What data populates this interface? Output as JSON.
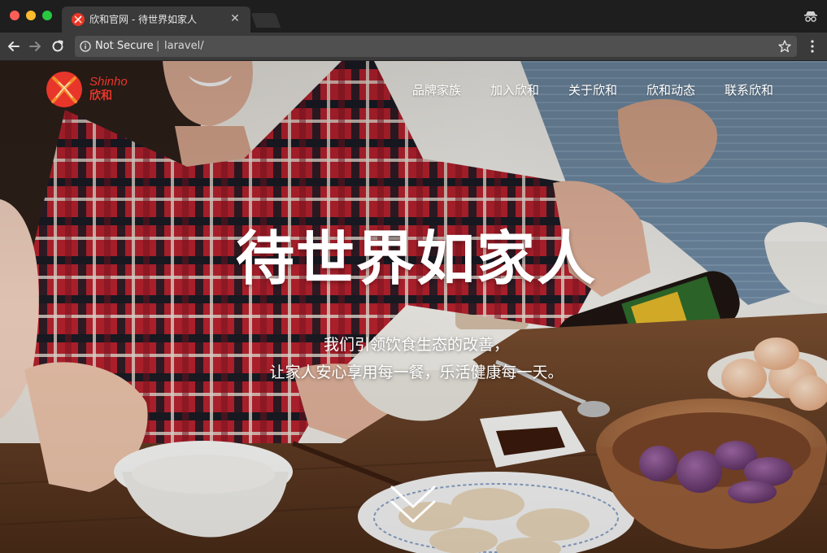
{
  "browser": {
    "tab": {
      "title": "欣和官网 - 待世界如家人"
    },
    "toolbar": {
      "security_label": "Not Secure",
      "separator": "|",
      "url": "laravel/"
    }
  },
  "site": {
    "logo": {
      "en": "Shinho",
      "cn": "欣和"
    },
    "nav": [
      {
        "label": "品牌家族"
      },
      {
        "label": "加入欣和"
      },
      {
        "label": "关于欣和"
      },
      {
        "label": "欣和动态"
      },
      {
        "label": "联系欣和"
      }
    ],
    "hero": {
      "title": "待世界如家人",
      "subtitle_line1": "我们引领饮食生态的改善，",
      "subtitle_line2": "让家人安心享用每一餐，乐活健康每一天。"
    }
  },
  "colors": {
    "brand_red": "#e8362b",
    "brand_orange": "#f28c28",
    "window_chrome": "#3a3a3a"
  }
}
